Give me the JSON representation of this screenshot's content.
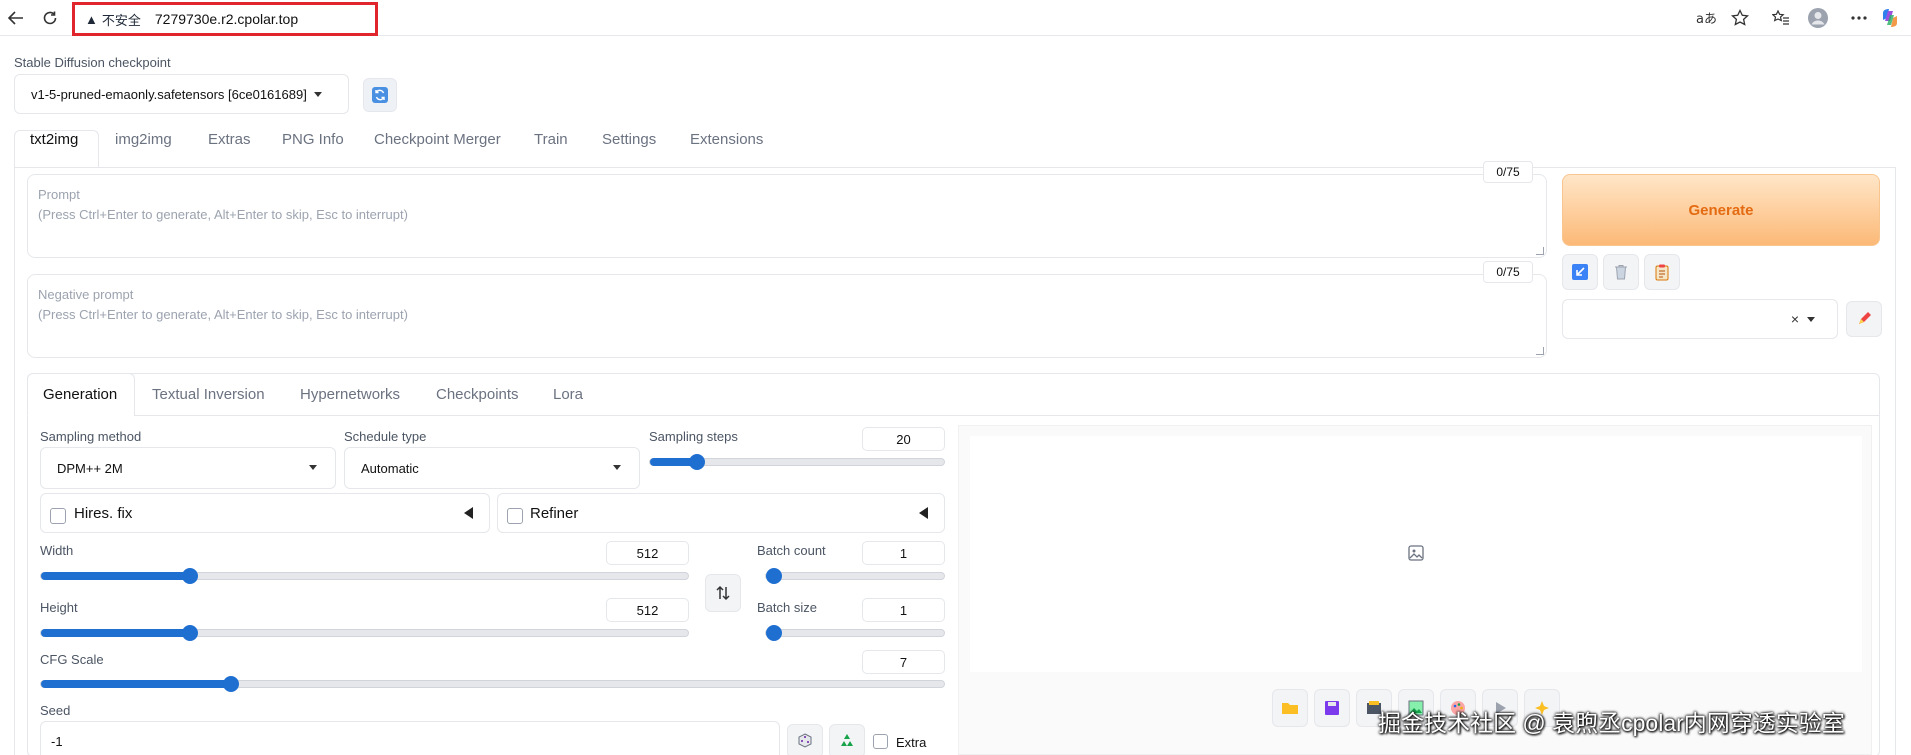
{
  "browser": {
    "security_label": "不安全",
    "url": "7279730e.r2.cpolar.top"
  },
  "checkpoint": {
    "label": "Stable Diffusion checkpoint",
    "value": "v1-5-pruned-emaonly.safetensors [6ce0161689]"
  },
  "tabs": [
    "txt2img",
    "img2img",
    "Extras",
    "PNG Info",
    "Checkpoint Merger",
    "Train",
    "Settings",
    "Extensions"
  ],
  "prompt": {
    "label": "Prompt",
    "hint": "(Press Ctrl+Enter to generate, Alt+Enter to skip, Esc to interrupt)",
    "counter": "0/75"
  },
  "negative_prompt": {
    "label": "Negative prompt",
    "hint": "(Press Ctrl+Enter to generate, Alt+Enter to skip, Esc to interrupt)",
    "counter": "0/75"
  },
  "generate_label": "Generate",
  "styles_clear": "×",
  "subtabs": [
    "Generation",
    "Textual Inversion",
    "Hypernetworks",
    "Checkpoints",
    "Lora"
  ],
  "sampling_method": {
    "label": "Sampling method",
    "value": "DPM++ 2M"
  },
  "schedule_type": {
    "label": "Schedule type",
    "value": "Automatic"
  },
  "sampling_steps": {
    "label": "Sampling steps",
    "value": "20",
    "fraction": 0.16
  },
  "hires_fix": {
    "label": "Hires. fix",
    "checked": false
  },
  "refiner": {
    "label": "Refiner",
    "checked": false
  },
  "width": {
    "label": "Width",
    "value": "512",
    "fraction": 0.23
  },
  "height": {
    "label": "Height",
    "value": "512",
    "fraction": 0.23
  },
  "batch_count": {
    "label": "Batch count",
    "value": "1",
    "fraction": 0.0
  },
  "batch_size": {
    "label": "Batch size",
    "value": "1",
    "fraction": 0.0
  },
  "cfg_scale": {
    "label": "CFG Scale",
    "value": "7",
    "fraction": 0.21
  },
  "seed": {
    "label": "Seed",
    "value": "-1"
  },
  "extra_label": "Extra",
  "watermark": "掘金技术社区 @ 袁煦丞cpolar内网穿透实验室",
  "colors": {
    "accent": "#1f6fd1",
    "generate_text": "#e46b12",
    "insecure_border": "#e0262c"
  }
}
